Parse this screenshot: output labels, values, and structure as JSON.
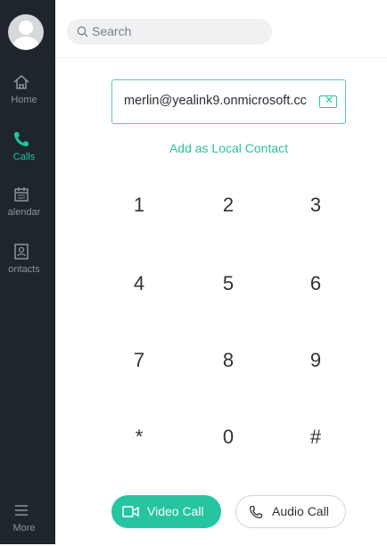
{
  "sidebar": {
    "items": [
      {
        "label": "Home",
        "icon": "home-icon"
      },
      {
        "label": "Calls",
        "icon": "phone-icon"
      },
      {
        "label": "alendar",
        "icon": "calendar-icon"
      },
      {
        "label": "ontacts",
        "icon": "contacts-icon"
      },
      {
        "label": "More",
        "icon": "menu-icon"
      }
    ],
    "active_item": "Calls",
    "colors": {
      "background": "#1e252c",
      "active": "#1cc6a0",
      "inactive": "#8b949c"
    }
  },
  "search": {
    "placeholder": "Search"
  },
  "dialer": {
    "input_value": "merlin@yealink9.onmicrosoft.cc",
    "add_local_label": "Add as Local Contact",
    "keys": [
      "1",
      "2",
      "3",
      "4",
      "5",
      "6",
      "7",
      "8",
      "9",
      "*",
      "0",
      "#"
    ]
  },
  "actions": {
    "video_call_label": "Video Call",
    "audio_call_label": "Audio Call"
  },
  "colors": {
    "accent": "#26c4a0"
  }
}
